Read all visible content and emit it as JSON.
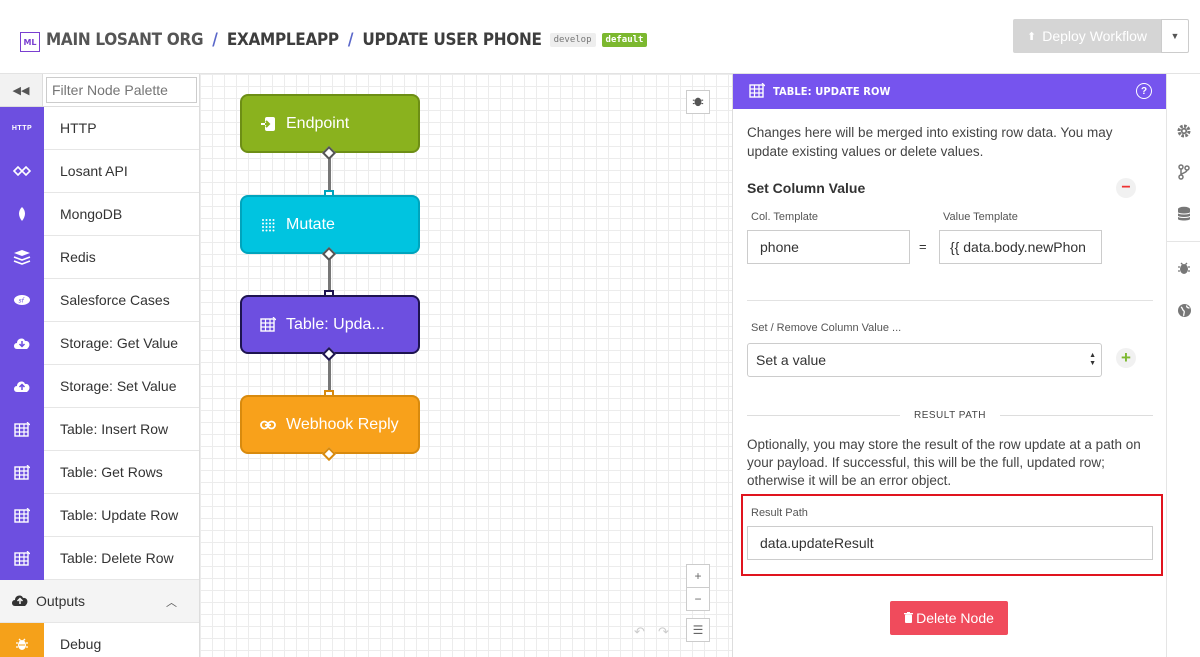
{
  "header": {
    "logo_text": "ML",
    "org": "MAIN LOSANT ORG",
    "separator": "/",
    "app": "EXAMPLEAPP",
    "workflow": "UPDATE USER PHONE",
    "version": "develop",
    "version_tag": "default",
    "deploy_label": "Deploy Workflow",
    "deploy_icon": "upload-icon"
  },
  "palette": {
    "filter_placeholder": "Filter Node Palette",
    "items": [
      {
        "label": "HTTP",
        "icon": "HTTP"
      },
      {
        "label": "Losant API",
        "icon": "losant-icon"
      },
      {
        "label": "MongoDB",
        "icon": "leaf-icon"
      },
      {
        "label": "Redis",
        "icon": "stack-icon"
      },
      {
        "label": "Salesforce Cases",
        "icon": "salesforce-icon"
      },
      {
        "label": "Storage: Get Value",
        "icon": "cloud-download-icon"
      },
      {
        "label": "Storage: Set Value",
        "icon": "cloud-upload-icon"
      },
      {
        "label": "Table: Insert Row",
        "icon": "table-icon"
      },
      {
        "label": "Table: Get Rows",
        "icon": "table-icon"
      },
      {
        "label": "Table: Update Row",
        "icon": "table-icon"
      },
      {
        "label": "Table: Delete Row",
        "icon": "table-icon"
      }
    ],
    "outputs_label": "Outputs",
    "debug_label": "Debug"
  },
  "canvas": {
    "nodes": [
      {
        "label": "Endpoint",
        "color": "#8ab21e"
      },
      {
        "label": "Mutate",
        "color": "#00c4e0"
      },
      {
        "label": "Table: Upda...",
        "color": "#6d4fe0"
      },
      {
        "label": "Webhook Reply",
        "color": "#f8a11b"
      }
    ],
    "zoom_in": "+",
    "zoom_out": "−"
  },
  "panel": {
    "title": "TABLE: UPDATE ROW",
    "help": "?",
    "description": "Changes here will be merged into existing row data. You may update existing values or delete values.",
    "set_column_title": "Set Column Value",
    "col_template_label": "Col. Template",
    "value_template_label": "Value Template",
    "col_template_value": "phone",
    "equals": "=",
    "value_template_value": "{{ data.body.newPhon",
    "set_remove_label": "Set / Remove Column Value ...",
    "select_value": "Set a value",
    "result_path_heading": "RESULT PATH",
    "result_path_description": "Optionally, you may store the result of the row update at a path on your payload. If successful, this will be the full, updated row; otherwise it will be an error object.",
    "result_path_label": "Result Path",
    "result_path_value": "data.updateResult",
    "delete_label": "Delete Node",
    "accent": "#7654ee",
    "highlight_color": "#e0141e"
  }
}
